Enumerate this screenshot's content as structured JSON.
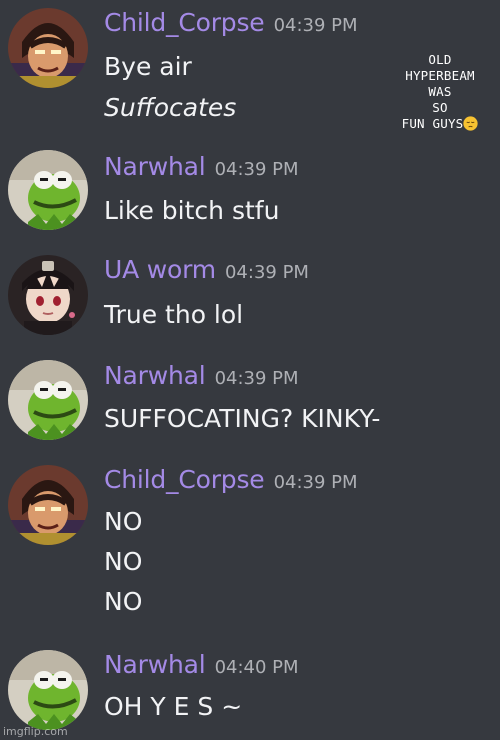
{
  "colors": {
    "background": "#36393f",
    "message_text": "#f2f3f5",
    "timestamp": "#aeb0b5",
    "username_purple": "#a48ae6"
  },
  "messages": [
    {
      "username": "Child_Corpse",
      "timestamp": "04:39 PM",
      "avatar_icon": "villain-avatar",
      "lines": [
        "Bye air",
        "Suffocates"
      ]
    },
    {
      "username": "Narwhal",
      "timestamp": "04:39 PM",
      "avatar_icon": "kermit-avatar",
      "lines": [
        "Like bitch stfu"
      ]
    },
    {
      "username": "UA worm",
      "timestamp": "04:39 PM",
      "avatar_icon": "anime-avatar",
      "lines": [
        "True tho lol"
      ]
    },
    {
      "username": "Narwhal",
      "timestamp": "04:39 PM",
      "avatar_icon": "kermit-avatar",
      "lines": [
        "SUFFOCATING? KINKY-"
      ]
    },
    {
      "username": "Child_Corpse",
      "timestamp": "04:39 PM",
      "avatar_icon": "villain-avatar",
      "lines": [
        "NO",
        "NO",
        "NO"
      ]
    },
    {
      "username": "Narwhal",
      "timestamp": "04:40 PM",
      "avatar_icon": "kermit-avatar",
      "lines": [
        "OH Y E S ~"
      ]
    }
  ],
  "overlay_note": {
    "lines": [
      "OLD",
      "HYPERBEAM",
      "WAS",
      "SO",
      "FUN GUYS"
    ],
    "emoji": "pensive-face-emoji"
  },
  "watermark": "imgflip.com"
}
